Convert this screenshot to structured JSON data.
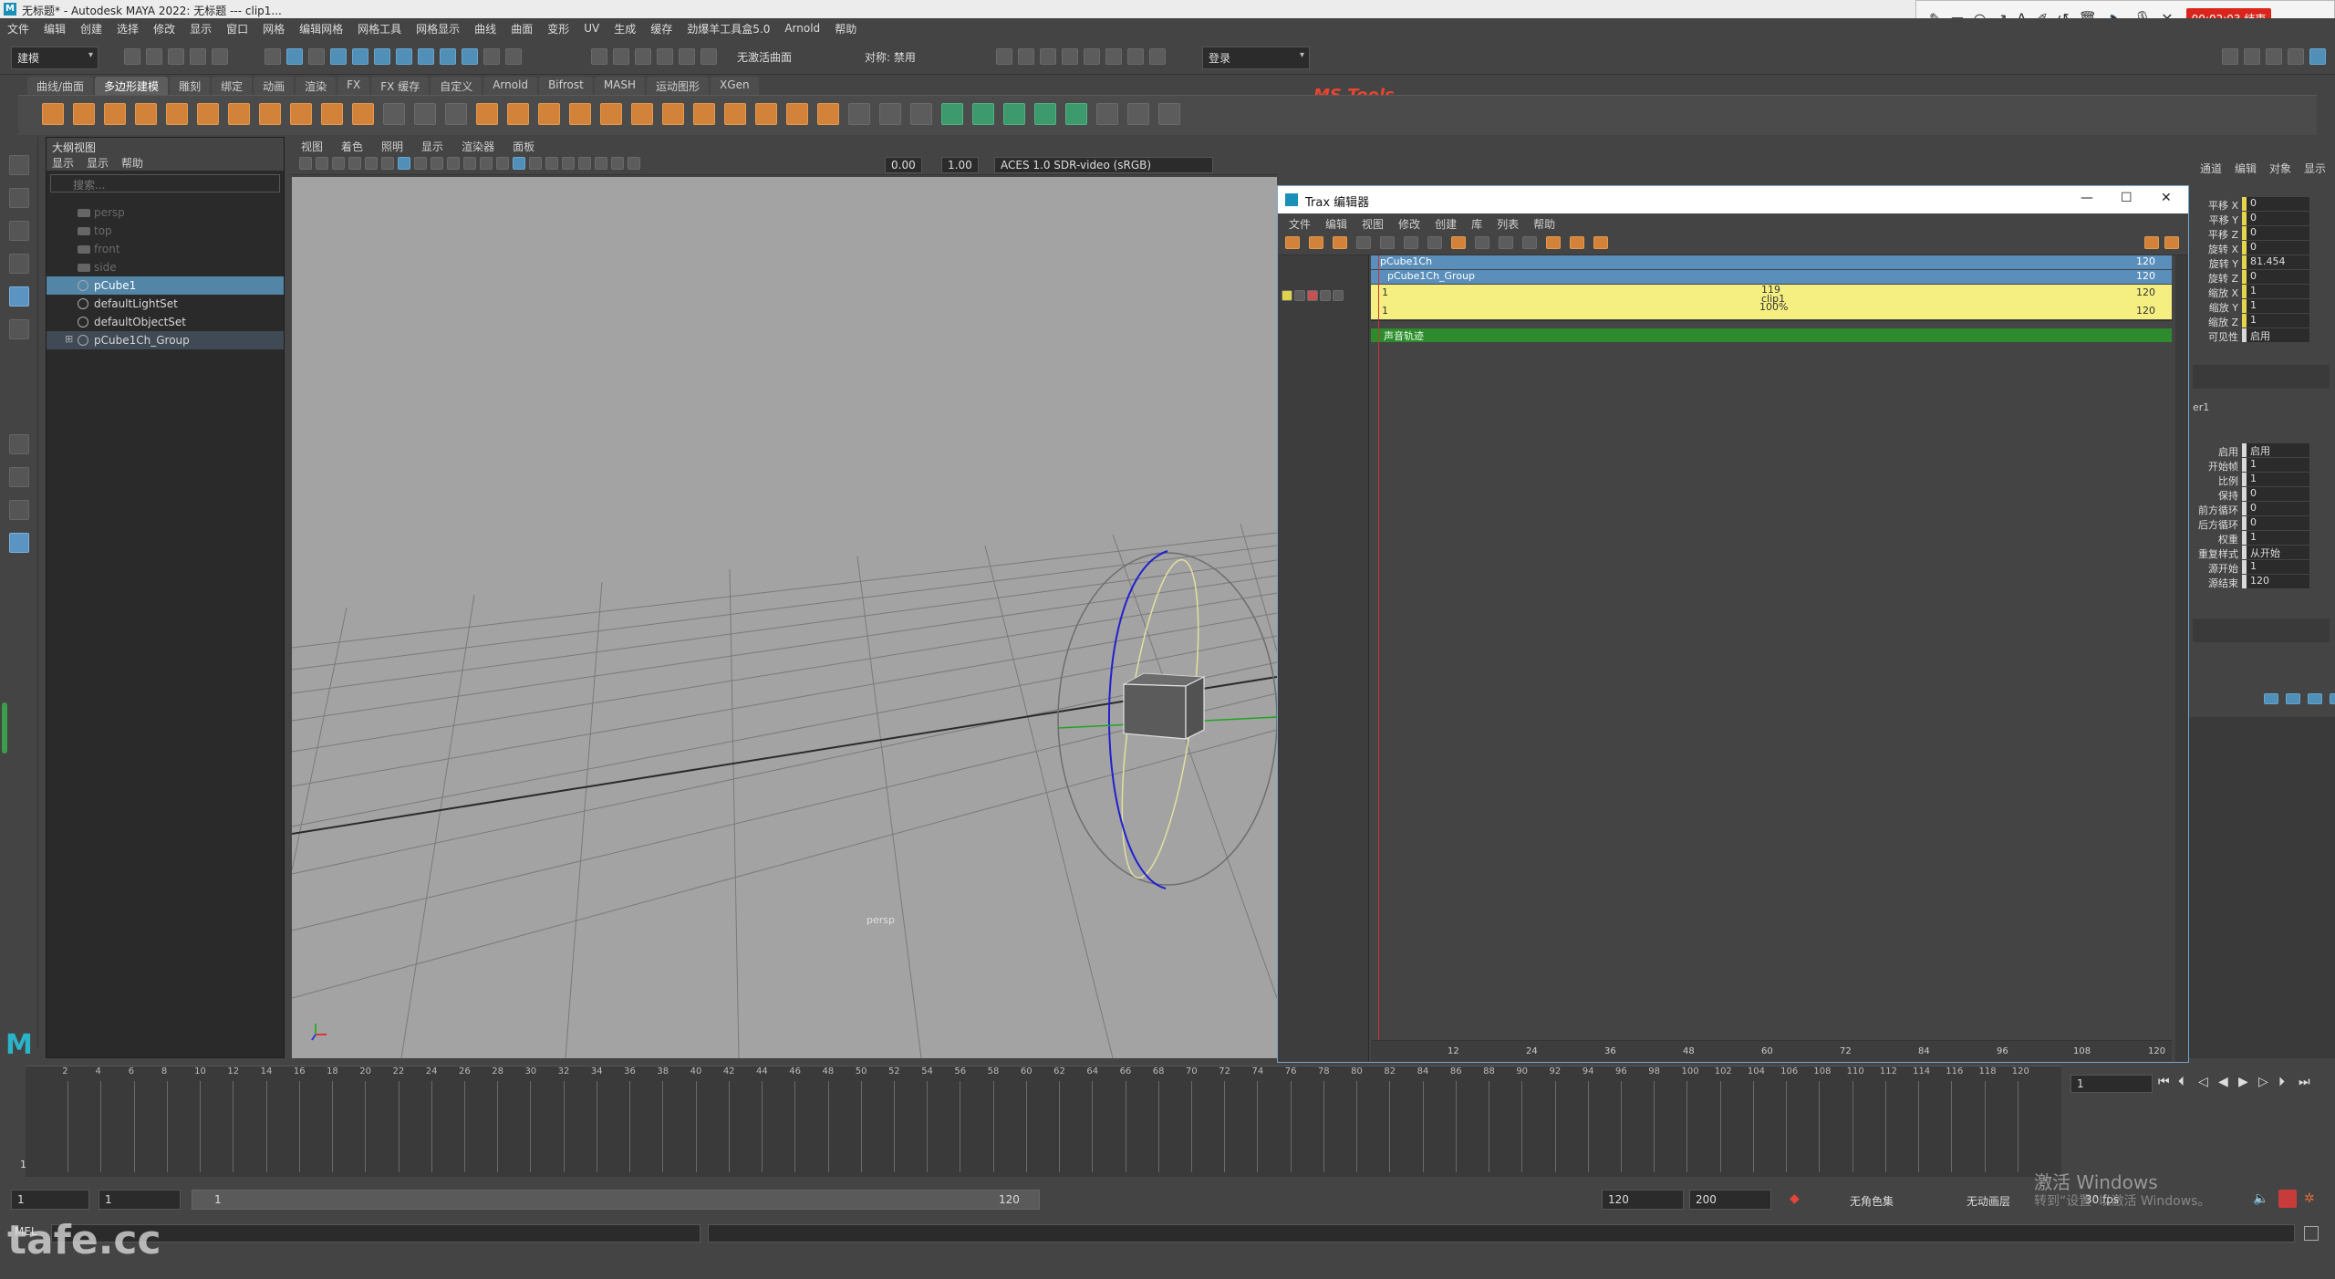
{
  "window": {
    "title": "无标题* - Autodesk MAYA 2022: 无标题  ---  clip1..."
  },
  "recorder": {
    "time": "00:02:03 结束"
  },
  "menubar": {
    "items": [
      "文件",
      "编辑",
      "创建",
      "选择",
      "修改",
      "显示",
      "窗口",
      "网格",
      "编辑网格",
      "网格工具",
      "网格显示",
      "曲线",
      "曲面",
      "变形",
      "UV",
      "生成",
      "缓存",
      "劲爆羊工具盒5.0",
      "Arnold",
      "帮助"
    ]
  },
  "statusline": {
    "menuset": "建模",
    "live_surface": "无激活曲面",
    "symmetry": "对称: 禁用",
    "login": "登录",
    "brand": "MS Tools"
  },
  "shelf": {
    "tabs": [
      "曲线/曲面",
      "多边形建模",
      "雕刻",
      "绑定",
      "动画",
      "渲染",
      "FX",
      "FX 缓存",
      "自定义",
      "Arnold",
      "Bifrost",
      "MASH",
      "运动图形",
      "XGen"
    ],
    "active_tab": 1
  },
  "outliner": {
    "title": "大纲视图",
    "menus": [
      "显示",
      "显示",
      "帮助"
    ],
    "search_placeholder": "搜索...",
    "items": [
      {
        "label": "persp",
        "dim": true
      },
      {
        "label": "top",
        "dim": true
      },
      {
        "label": "front",
        "dim": true
      },
      {
        "label": "side",
        "dim": true
      },
      {
        "label": "pCube1",
        "selected": true
      },
      {
        "label": "defaultLightSet"
      },
      {
        "label": "defaultObjectSet"
      },
      {
        "label": "pCube1Ch_Group",
        "group": true
      }
    ]
  },
  "viewport": {
    "menus": [
      "视图",
      "着色",
      "照明",
      "显示",
      "渲染器",
      "面板"
    ],
    "exposure": "0.00",
    "gamma": "1.00",
    "color_space": "ACES 1.0 SDR-video (sRGB)",
    "camera_label": "persp"
  },
  "trax": {
    "title": "Trax 编辑器",
    "menus": [
      "文件",
      "编辑",
      "视图",
      "修改",
      "创建",
      "库",
      "列表",
      "帮助"
    ],
    "character_track": {
      "label": "pCube1Ch",
      "end": "120"
    },
    "group_track": {
      "label": "pCube1Ch_Group",
      "end": "120"
    },
    "clip": {
      "start": "1",
      "end": "120",
      "length": "119",
      "name": "clip1",
      "weight": "100%",
      "start2": "1",
      "end2": "120"
    },
    "sound_track": "声音轨迹",
    "ruler_ticks": [
      "12",
      "24",
      "36",
      "48",
      "60",
      "72",
      "84",
      "96",
      "108",
      "120"
    ],
    "window_buttons": {
      "minimize": "—",
      "maximize": "☐",
      "close": "✕"
    }
  },
  "channelbox": {
    "menus": [
      "通道",
      "编辑",
      "对象",
      "显示"
    ],
    "channels": [
      {
        "label": "平移 X",
        "value": "0"
      },
      {
        "label": "平移 Y",
        "value": "0"
      },
      {
        "label": "平移 Z",
        "value": "0"
      },
      {
        "label": "旋转 X",
        "value": "0"
      },
      {
        "label": "旋转 Y",
        "value": "81.454"
      },
      {
        "label": "旋转 Z",
        "value": "0"
      },
      {
        "label": "缩放 X",
        "value": "1"
      },
      {
        "label": "缩放 Y",
        "value": "1"
      },
      {
        "label": "缩放 Z",
        "value": "1"
      },
      {
        "label": "可见性",
        "value": "启用"
      }
    ],
    "clip_section": "er1",
    "clip_attrs": [
      {
        "label": "启用",
        "value": "启用"
      },
      {
        "label": "开始帧",
        "value": "1"
      },
      {
        "label": "比例",
        "value": "1"
      },
      {
        "label": "保持",
        "value": "0"
      },
      {
        "label": "前方循环",
        "value": "0"
      },
      {
        "label": "后方循环",
        "value": "0"
      },
      {
        "label": "权重",
        "value": "1"
      },
      {
        "label": "重复样式",
        "value": "从开始"
      },
      {
        "label": "源开始",
        "value": "1"
      },
      {
        "label": "源结束",
        "value": "120"
      }
    ]
  },
  "timeslider": {
    "ticks": [
      "2",
      "4",
      "6",
      "8",
      "10",
      "12",
      "14",
      "16",
      "18",
      "20",
      "22",
      "24",
      "26",
      "28",
      "30",
      "32",
      "34",
      "36",
      "38",
      "40",
      "42",
      "44",
      "46",
      "48",
      "50",
      "52",
      "54",
      "56",
      "58",
      "60",
      "62",
      "64",
      "66",
      "68",
      "70",
      "72",
      "74",
      "76",
      "78",
      "80",
      "82",
      "84",
      "86",
      "88",
      "90",
      "92",
      "94",
      "96",
      "98",
      "100",
      "102",
      "104",
      "106",
      "108",
      "110",
      "112",
      "114",
      "116",
      "118",
      "120"
    ],
    "current_frame": "1",
    "current_field": "1"
  },
  "rangebar": {
    "start": "1",
    "anim_start": "1",
    "slider_start": "1",
    "slider_end": "120",
    "end": "120",
    "anim_end": "200",
    "char_set": "无角色集",
    "anim_layer": "无动画层",
    "fps": "30 fps"
  },
  "cmdline": {
    "mel": "MEL"
  },
  "overlay": {
    "watermark": "tafe.cc",
    "activate_line1": "激活 Windows",
    "activate_line2": "转到“设置”以激活 Windows。"
  }
}
